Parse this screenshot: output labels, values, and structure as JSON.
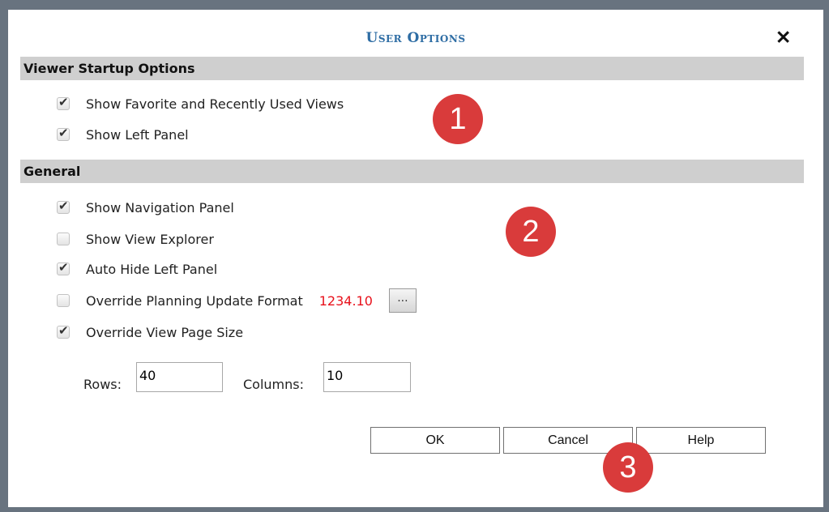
{
  "dialog": {
    "title": "User Options",
    "close_symbol": "✕"
  },
  "sections": {
    "startup": {
      "header": "Viewer Startup Options",
      "items": [
        {
          "label": "Show Favorite and Recently Used Views",
          "checked": true
        },
        {
          "label": "Show Left Panel",
          "checked": true
        }
      ]
    },
    "general": {
      "header": "General",
      "items": [
        {
          "label": "Show Navigation Panel",
          "checked": true
        },
        {
          "label": "Show View Explorer",
          "checked": false
        },
        {
          "label": "Auto Hide Left Panel",
          "checked": true
        },
        {
          "label": "Override Planning Update Format",
          "checked": false
        },
        {
          "label": "Override View Page Size",
          "checked": true
        }
      ],
      "format_sample": "1234.10",
      "format_button_label": "...",
      "rows_label": "Rows:",
      "rows_value": "40",
      "columns_label": "Columns:",
      "columns_value": "10"
    }
  },
  "buttons": {
    "ok": "OK",
    "cancel": "Cancel",
    "help": "Help"
  },
  "callouts": [
    "1",
    "2",
    "3"
  ],
  "colors": {
    "title": "#2e6da4",
    "section_bg": "#cfcfcf",
    "format_sample": "#e8111b",
    "callout": "#d93b3b",
    "backdrop": "#68737f"
  }
}
